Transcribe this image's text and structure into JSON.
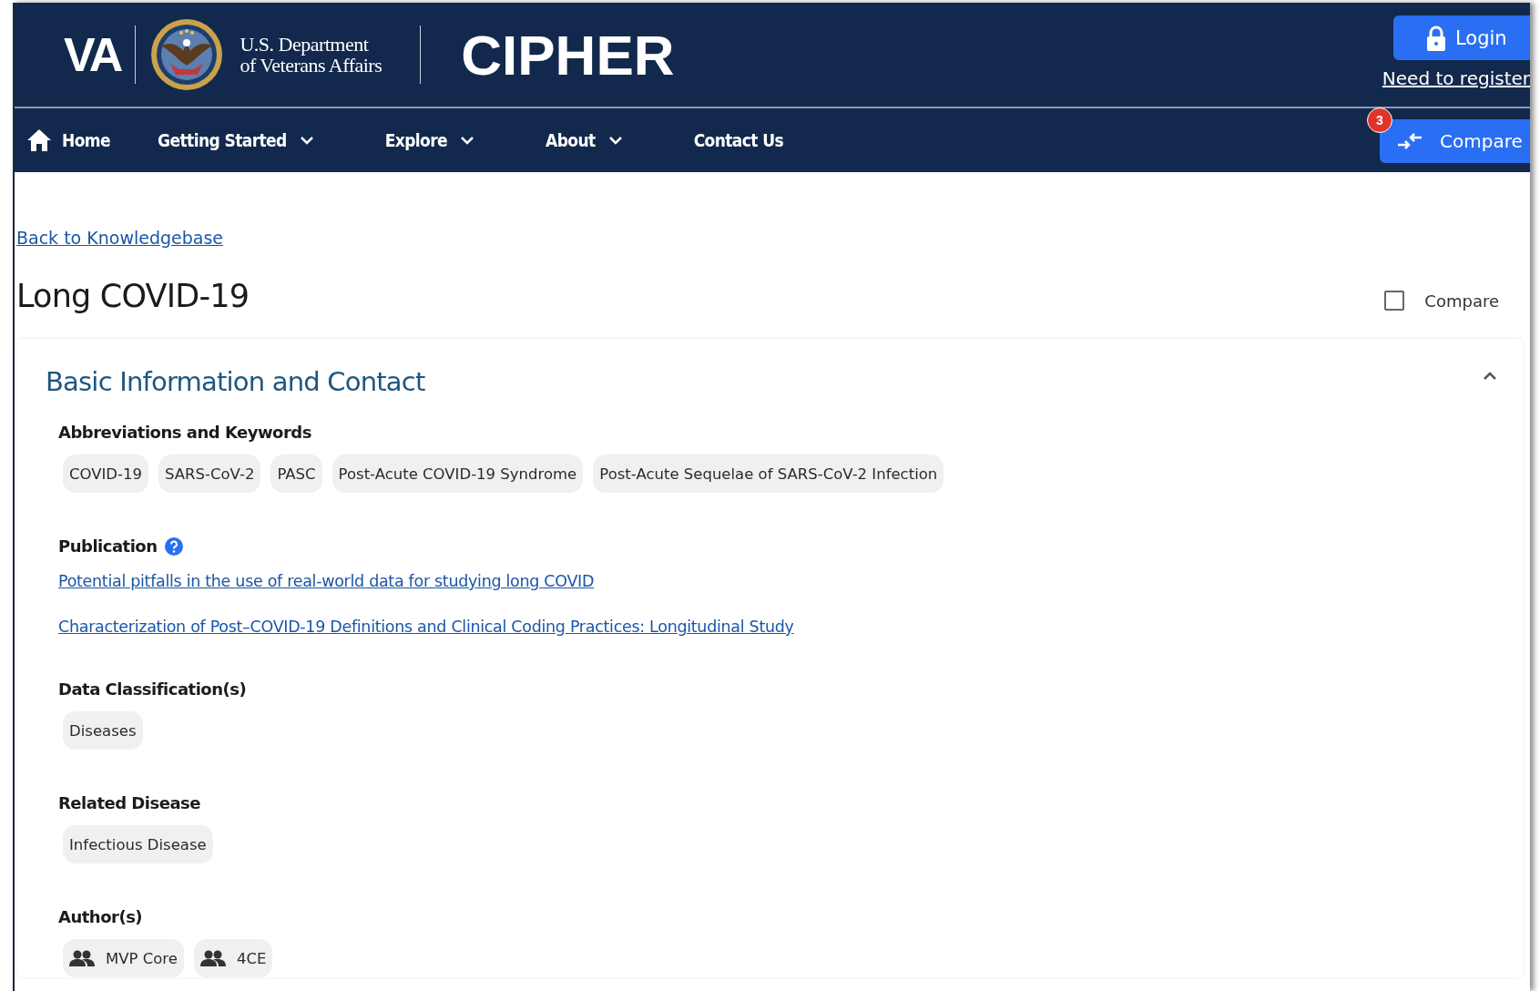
{
  "header": {
    "logo_text": "VA",
    "department_lines": [
      "U.S. Department",
      "of Veterans Affairs"
    ],
    "app_title": "CIPHER",
    "login_button": "Login",
    "register_link": "Need to register"
  },
  "nav": {
    "items": [
      {
        "label": "Home",
        "kind": "home"
      },
      {
        "label": "Getting Started",
        "kind": "dropdown"
      },
      {
        "label": "Explore",
        "kind": "dropdown"
      },
      {
        "label": "About",
        "kind": "dropdown"
      },
      {
        "label": "Contact Us",
        "kind": "link"
      }
    ],
    "compare_button": {
      "label": "Compare",
      "badge": "3"
    }
  },
  "page": {
    "back_link": "Back to Knowledgebase",
    "title": "Long COVID-19",
    "compare_checkbox": {
      "label": "Compare",
      "checked": false
    }
  },
  "section": {
    "title": "Basic Information and Contact",
    "expanded": true,
    "groups": [
      {
        "label": "Abbreviations and Keywords",
        "kind": "chips",
        "help": false,
        "items": [
          "COVID-19",
          "SARS-CoV-2",
          "PASC",
          "Post-Acute COVID-19 Syndrome",
          "Post-Acute Sequelae of SARS-CoV-2 Infection"
        ]
      },
      {
        "label": "Publication",
        "kind": "links",
        "help": true,
        "items": [
          "Potential pitfalls in the use of real-world data for studying long COVID",
          "Characterization of Post–COVID-19 Definitions and Clinical Coding Practices: Longitudinal Study"
        ]
      },
      {
        "label": "Data Classification(s)",
        "kind": "chips",
        "help": false,
        "items": [
          "Diseases"
        ]
      },
      {
        "label": "Related Disease",
        "kind": "chips",
        "help": false,
        "items": [
          "Infectious Disease"
        ]
      },
      {
        "label": "Author(s)",
        "kind": "authors",
        "help": false,
        "items": [
          "MVP Core",
          "4CE"
        ]
      }
    ]
  }
}
